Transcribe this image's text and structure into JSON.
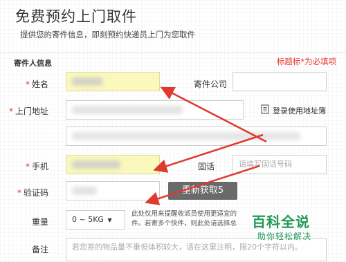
{
  "header": {
    "title": "免费预约上门取件",
    "subtitle": "提供您的寄件信息，即刻预约快递员上门为您取件"
  },
  "sender_section": {
    "title": "寄件人信息",
    "required_note": "标题标*为必填项"
  },
  "form": {
    "name_label": "姓名",
    "company_label": "寄件公司",
    "address_label": "上门地址",
    "address_book_link": "登录使用地址簿",
    "phone_label": "手机",
    "landline_label": "固话",
    "landline_placeholder": "请填写固话号码",
    "captcha_label": "验证码",
    "captcha_button": "重新获取5",
    "weight_label": "重量",
    "weight_value": "0 ~ 5KG",
    "weight_note_line1": "此处仅用来提醒收派员使用更适宜的",
    "weight_note_line2": "件。若寄多个快件，则此处请选择总",
    "remarks_label": "备注",
    "remarks_placeholder": "若您寄的物品量不重但体积较大，请在这里注明，限20个字符以内。"
  },
  "watermark": {
    "text": "百科全说",
    "sub": "助你轻松解决"
  },
  "colors": {
    "required": "#e8372c",
    "highlight": "#faf8bd",
    "annotation_arrow": "#e03a2e",
    "watermark": "#1f9a54"
  },
  "icons": {
    "address_book": "address-book-icon",
    "dropdown": "caret-down-icon"
  }
}
